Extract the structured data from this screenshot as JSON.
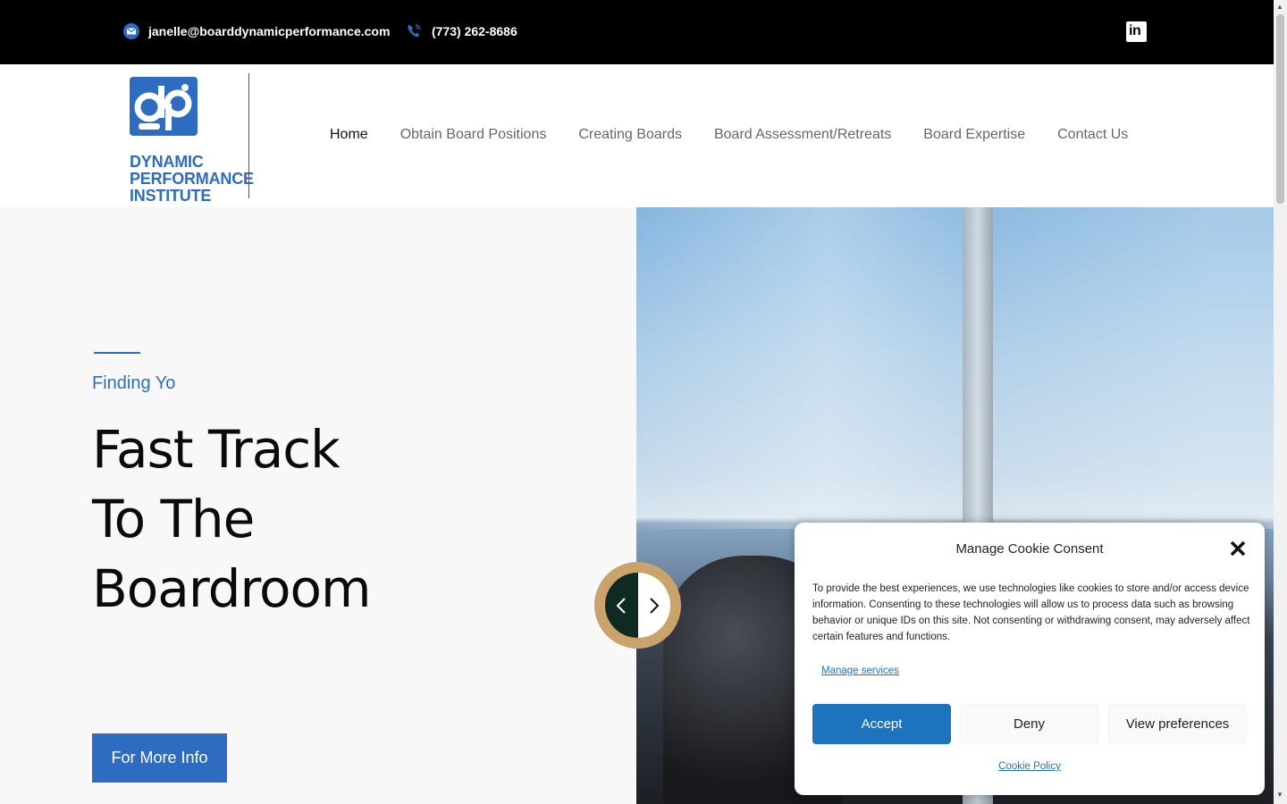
{
  "topbar": {
    "email": "janelle@boarddynamicperformance.com",
    "phone": "(773) 262-8686",
    "social_icon": "linkedin-icon",
    "social_text": "in"
  },
  "header": {
    "logo_lines": [
      "DYNAMIC",
      "PERFORMANCE",
      "INSTITUTE"
    ],
    "logo_mark": "dp",
    "nav": [
      "Home",
      "Obtain Board Positions",
      "Creating Boards",
      "Board Assessment/Retreats",
      "Board Expertise",
      "Contact Us"
    ]
  },
  "hero": {
    "subtitle": "Finding Yo",
    "title_lines": [
      "Fast Track",
      "To The",
      "Boardroom"
    ],
    "cta": "For More Info"
  },
  "slider": {
    "prev_icon": "chevron-left-icon",
    "next_icon": "chevron-right-icon"
  },
  "cookie": {
    "title": "Manage Cookie Consent",
    "text": "To provide the best experiences, we use technologies like cookies to store and/or access device information. Consenting to these technologies will allow us to process data such as browsing behavior or unique IDs on this site. Not consenting or withdrawing consent, may adversely affect certain features and functions.",
    "manage": "Manage services",
    "accept": "Accept",
    "deny": "Deny",
    "preferences": "View preferences",
    "policy": "Cookie Policy"
  },
  "colors": {
    "brand_blue": "#2d6cc0",
    "accept_blue": "#1e73be",
    "gold": "#c9a36b"
  }
}
